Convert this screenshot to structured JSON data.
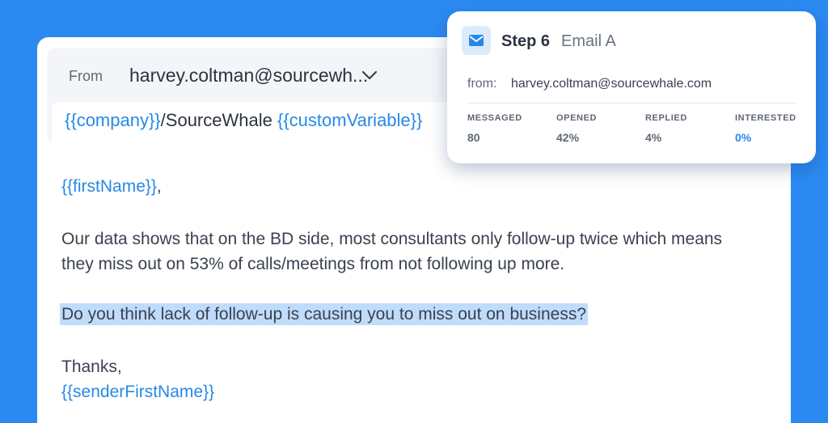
{
  "email": {
    "from_label": "From",
    "from_value": "harvey.coltman@sourcewh...",
    "subject": {
      "var1": "{{company}}",
      "middle": "/SourceWhale ",
      "var2": "{{customVariable}}"
    },
    "greeting_var": "{{firstName}}",
    "greeting_suffix": ",",
    "paragraph1_line1": "Our data shows that on the BD side, most consultants only follow-up twice which means",
    "paragraph1_line2": "they miss out on 53% of calls/meetings from not following up more.",
    "highlighted_question": "Do you think lack of follow-up is causing you to miss out on business?",
    "signoff": "Thanks,",
    "signature_var": "{{senderFirstName}}"
  },
  "popup": {
    "icon": "mail-icon",
    "step_label": "Step 6",
    "step_name": "Email A",
    "from_label": "from:",
    "from_value": "harvey.coltman@sourcewhale.com",
    "stats": [
      {
        "label": "MESSAGED",
        "value": "80"
      },
      {
        "label": "OPENED",
        "value": "42%"
      },
      {
        "label": "REPLIED",
        "value": "4%"
      },
      {
        "label": "INTERESTED",
        "value": "0%"
      }
    ]
  },
  "colors": {
    "background": "#2b8af2",
    "accent": "#2589e8",
    "highlight": "#bfdcfb"
  }
}
